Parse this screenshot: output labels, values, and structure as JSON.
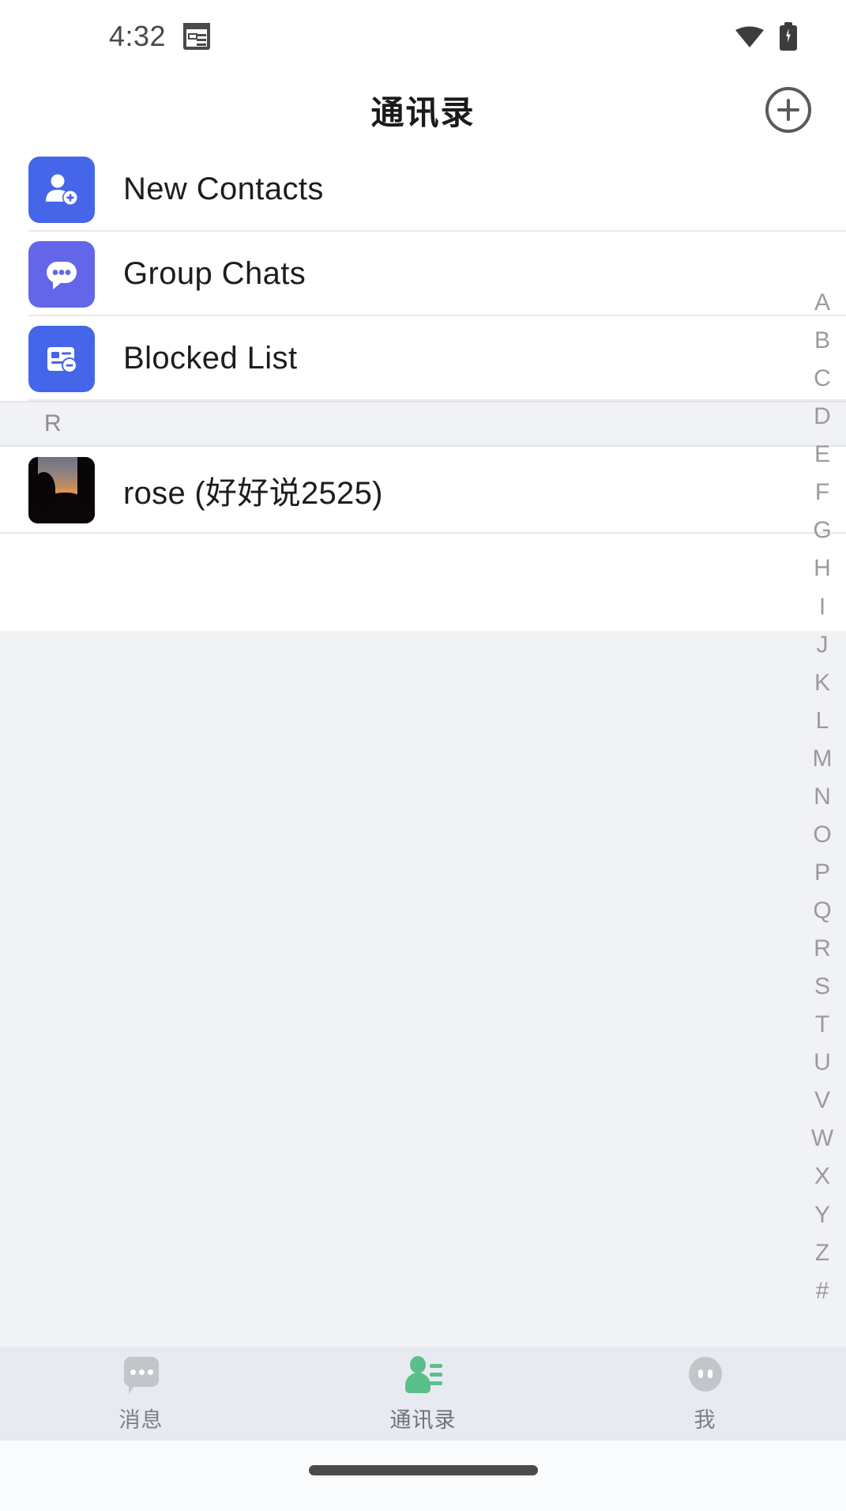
{
  "status_bar": {
    "time": "4:32",
    "icons": [
      "notes-icon",
      "wifi-icon",
      "battery-charging-icon"
    ]
  },
  "header": {
    "title": "通讯录",
    "add_button": "add-contact-icon"
  },
  "menu_items": [
    {
      "label": "New Contacts",
      "icon": "person-add-icon",
      "color": "#4566e8"
    },
    {
      "label": "Group Chats",
      "icon": "chat-bubble-dots-icon",
      "color": "#6366e8"
    },
    {
      "label": "Blocked List",
      "icon": "card-block-icon",
      "color": "#4566e8"
    }
  ],
  "sections": [
    {
      "letter": "R",
      "contacts": [
        {
          "name": "rose (好好说2525)",
          "avatar": "dusk-photo-avatar"
        }
      ]
    }
  ],
  "index_bar": {
    "letters": [
      "A",
      "B",
      "C",
      "D",
      "E",
      "F",
      "G",
      "H",
      "I",
      "J",
      "K",
      "L",
      "M",
      "N",
      "O",
      "P",
      "Q",
      "R",
      "S",
      "T",
      "U",
      "V",
      "W",
      "X",
      "Y",
      "Z",
      "#"
    ]
  },
  "bottom_nav": {
    "items": [
      {
        "label": "消息",
        "icon": "message-bubble-icon",
        "active": false
      },
      {
        "label": "通讯录",
        "icon": "contacts-person-icon",
        "active": true
      },
      {
        "label": "我",
        "icon": "profile-face-icon",
        "active": false
      }
    ],
    "active_color": "#5bbf8a",
    "inactive_color": "#c2c6cb"
  }
}
